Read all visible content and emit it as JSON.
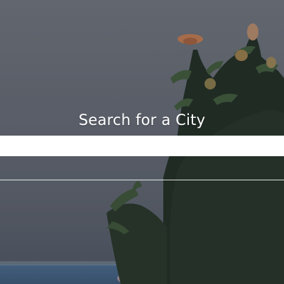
{
  "search": {
    "title": "Search for a City",
    "value": "",
    "placeholder": ""
  },
  "colors": {
    "title_text": "#ffffff",
    "input_background": "#ffffff",
    "divider": "#ffffff"
  },
  "background": {
    "description_icon": "plant-photo"
  }
}
